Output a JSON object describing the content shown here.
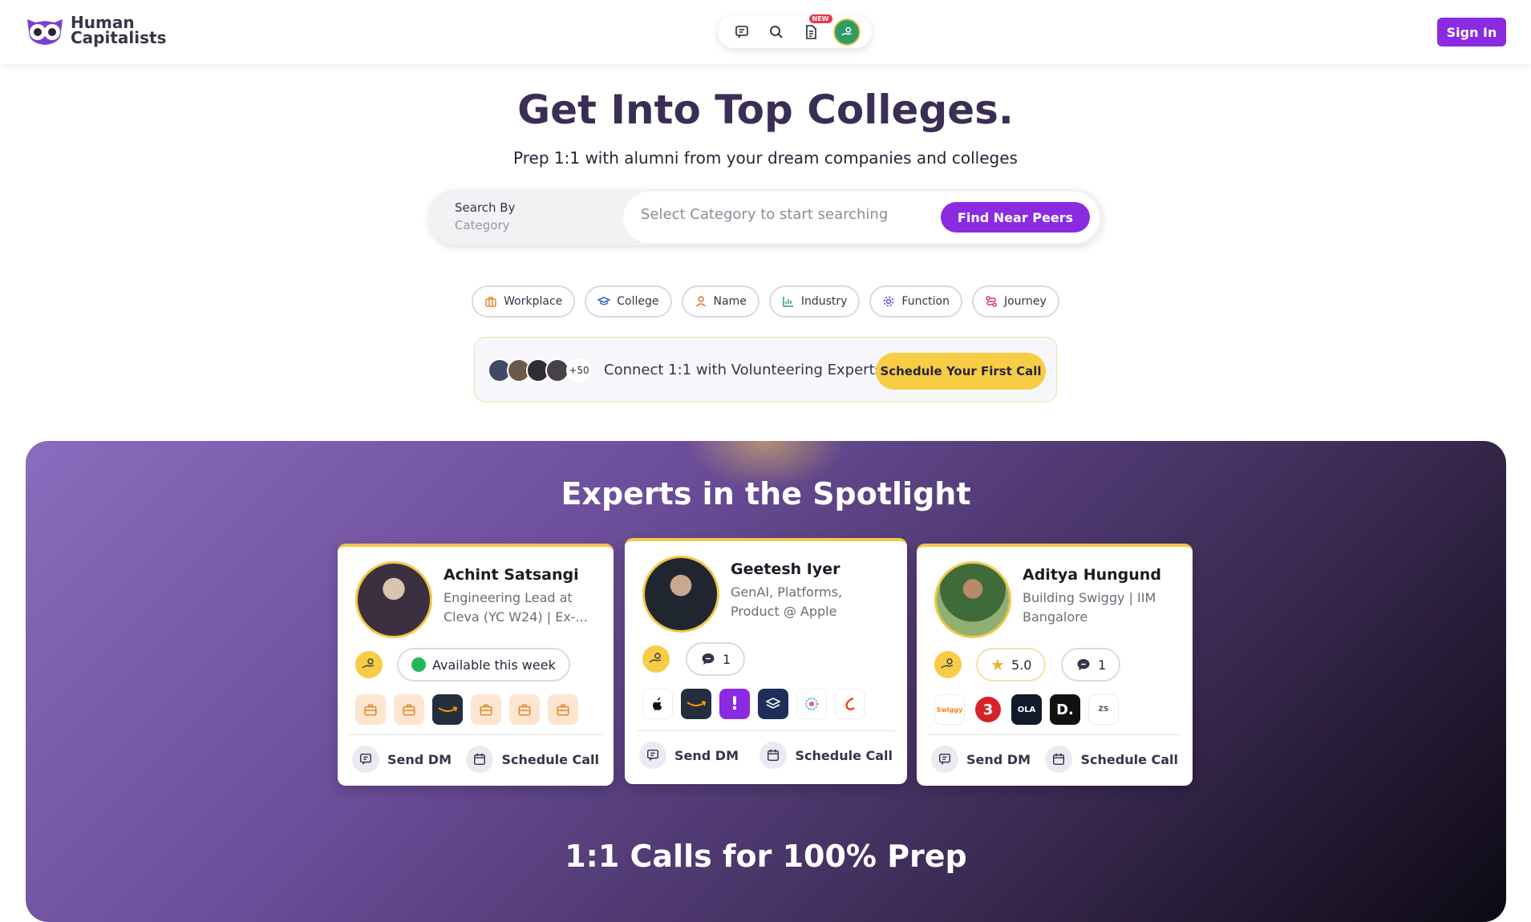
{
  "header": {
    "logo_line1": "Human",
    "logo_line2": "Capitalists",
    "new_badge": "NEW",
    "sign_in_label": "Sign In"
  },
  "hero": {
    "title": "Get Into Top Colleges.",
    "subtitle": "Prep 1:1 with alumni from your dream companies and colleges"
  },
  "search": {
    "search_by_label": "Search By",
    "search_by_value": "Category",
    "placeholder": "Select Category to start searching",
    "button_label": "Find Near Peers"
  },
  "categories": [
    {
      "label": "Workplace",
      "icon": "briefcase-icon",
      "color": "#e08a2e"
    },
    {
      "label": "College",
      "icon": "graduation-cap-icon",
      "color": "#3a6bd6"
    },
    {
      "label": "Name",
      "icon": "user-icon",
      "color": "#e0702e"
    },
    {
      "label": "Industry",
      "icon": "chart-icon",
      "color": "#2e9e5a"
    },
    {
      "label": "Function",
      "icon": "gear-icon",
      "color": "#5a4fd6"
    },
    {
      "label": "Journey",
      "icon": "route-icon",
      "color": "#e03a5a"
    }
  ],
  "connect": {
    "more_count": "+50",
    "text": "Connect 1:1 with Volunteering Experts",
    "button_label": "Schedule Your First Call"
  },
  "spotlight": {
    "title": "Experts in the Spotlight",
    "cards": [
      {
        "name": "Achint Satsangi",
        "desc": "Engineering Lead at Cleva (YC W24) | Ex-...",
        "availability": "Available this week",
        "send_dm": "Send DM",
        "schedule_call": "Schedule Call"
      },
      {
        "name": "Geetesh Iyer",
        "desc": "GenAI, Platforms, Product @ Apple",
        "message_count": "1",
        "send_dm": "Send DM",
        "schedule_call": "Schedule Call"
      },
      {
        "name": "Aditya Hungund",
        "desc": "Building Swiggy | IIM Bangalore",
        "rating": "5.0",
        "message_count": "1",
        "logo_labels": [
          "Swiggy",
          "3",
          "OLA",
          "D.",
          "ZS"
        ],
        "send_dm": "Send DM",
        "schedule_call": "Schedule Call"
      }
    ]
  },
  "calls_section": {
    "title": "1:1 Calls for 100% Prep"
  },
  "colors": {
    "accent": "#8a2be2",
    "yellow": "#f7cd46",
    "title_purple": "#3b2e55"
  }
}
